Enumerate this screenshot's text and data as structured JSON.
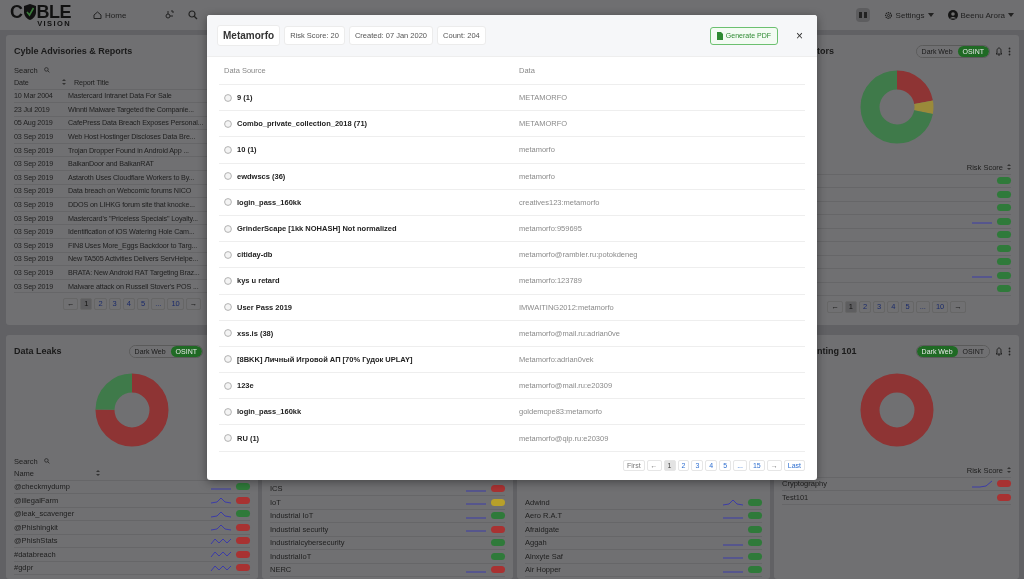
{
  "topbar": {
    "logo": {
      "left": "C",
      "right": "BLE",
      "tagline": "VISION"
    },
    "home": "Home",
    "settings": "Settings",
    "user": "Beenu Arora"
  },
  "advisories": {
    "title": "Cyble Advisories & Reports",
    "search": {
      "placeholder": "Search"
    },
    "columns": [
      "Date",
      "Report Title"
    ],
    "rows": [
      {
        "date": "10 Mar 2004",
        "title": "Mastercard Intranet Data For Sale"
      },
      {
        "date": "23 Jul 2019",
        "title": "Winnti Malware Targeted the Companie..."
      },
      {
        "date": "05 Aug 2019",
        "title": "CafePress Data Breach Exposes Personal..."
      },
      {
        "date": "03 Sep 2019",
        "title": "Web Host Hostinger Discloses Data Bre..."
      },
      {
        "date": "03 Sep 2019",
        "title": "Trojan Dropper Found in Android App ..."
      },
      {
        "date": "03 Sep 2019",
        "title": "BalkanDoor and BalkanRAT"
      },
      {
        "date": "03 Sep 2019",
        "title": "Astaroth Uses Cloudflare Workers to By..."
      },
      {
        "date": "03 Sep 2019",
        "title": "Data breach on Webcomic forums NICO"
      },
      {
        "date": "03 Sep 2019",
        "title": "DDOS on LIHKG forum site that knocke..."
      },
      {
        "date": "03 Sep 2019",
        "title": "Mastercard's \"Priceless Specials\" Loyalty..."
      },
      {
        "date": "03 Sep 2019",
        "title": "Identification of iOS Watering Hole Cam..."
      },
      {
        "date": "03 Sep 2019",
        "title": "FIN8 Uses More_Eggs Backdoor to Targ..."
      },
      {
        "date": "03 Sep 2019",
        "title": "New TA505 Activities Delivers ServHelpe..."
      },
      {
        "date": "03 Sep 2019",
        "title": "BRATA: New Android RAT Targeting Braz..."
      },
      {
        "date": "03 Sep 2019",
        "title": "Malware attack on Russell Stover's POS ..."
      }
    ],
    "pagination": {
      "prev": "←",
      "next": "→",
      "pages": [
        {
          "label": "1",
          "selected": true
        },
        {
          "label": "2",
          "selected": false
        },
        {
          "label": "3",
          "selected": false
        },
        {
          "label": "4",
          "selected": false
        },
        {
          "label": "5",
          "selected": false
        },
        {
          "label": "...",
          "selected": false
        },
        {
          "label": "10",
          "selected": false
        }
      ]
    }
  },
  "threat_panel": {
    "title": "tors",
    "toggle": [
      {
        "label": "Dark Web",
        "selected": false
      },
      {
        "label": "OSINT",
        "selected": true
      }
    ],
    "risk_header": "Risk Score",
    "rows": [
      {
        "color": "#2f7a3a"
      },
      {
        "color": "#2f7a3a"
      },
      {
        "color": "#2f7a3a"
      },
      {
        "color": "#2f7a3a",
        "kind": "flat"
      },
      {
        "color": "#2f7a3a"
      },
      {
        "color": "#2f7a3a"
      },
      {
        "color": "#2f7a3a"
      },
      {
        "color": "#2f7a3a",
        "kind": "flat"
      },
      {
        "color": "#2f7a3a"
      }
    ],
    "pagination": {
      "prev": "←",
      "next": "→",
      "pages": [
        {
          "label": "1",
          "selected": true
        },
        {
          "label": "2",
          "selected": false
        },
        {
          "label": "3",
          "selected": false
        },
        {
          "label": "4",
          "selected": false
        },
        {
          "label": "5",
          "selected": false
        },
        {
          "label": "...",
          "selected": false
        },
        {
          "label": "10",
          "selected": false
        }
      ]
    }
  },
  "data_leaks": {
    "title": "Data Leaks",
    "toggle": [
      {
        "label": "Dark Web",
        "selected": false
      },
      {
        "label": "OSINT",
        "selected": true
      }
    ],
    "search": {
      "placeholder": "Search"
    },
    "name_header": "Name",
    "rows": [
      {
        "name": "@checkmydump",
        "kind": "flat",
        "color": "#2f7a3a"
      },
      {
        "name": "@illegalFarm",
        "kind": "hump",
        "color": "#a83232"
      },
      {
        "name": "@leak_scavenger",
        "kind": "hump",
        "color": "#2f7a3a"
      },
      {
        "name": "@Phishingkit",
        "kind": "hump",
        "color": "#a83232"
      },
      {
        "name": "@PhishStats",
        "kind": "wave",
        "color": "#a83232"
      },
      {
        "name": "#databreach",
        "kind": "wave",
        "color": "#a83232"
      },
      {
        "name": "#gdpr",
        "kind": "wave",
        "color": "#a83232"
      }
    ]
  },
  "keyword_panel": {
    "rows": [
      {
        "name": "ICS",
        "kind": "flat",
        "color": "#a83232"
      },
      {
        "name": "IoT",
        "kind": "flat",
        "color": "#b8a02a"
      },
      {
        "name": "Industrial IoT",
        "kind": "flat",
        "color": "#2f7a3a"
      },
      {
        "name": "Industrial security",
        "kind": "flat",
        "color": "#a83232"
      },
      {
        "name": "Industrialcybersecurity",
        "color": "#2f7a3a"
      },
      {
        "name": "IndustrialIoT",
        "color": "#2f7a3a"
      },
      {
        "name": "NERC",
        "kind": "flat",
        "color": "#a83232"
      }
    ]
  },
  "malware_panel": {
    "rows": [
      {
        "name": "Adwind",
        "kind": "hump",
        "color": "#2f7a3a"
      },
      {
        "name": "Aero R.A.T",
        "kind": "flat",
        "color": "#2f7a3a"
      },
      {
        "name": "Afraidgate",
        "color": "#2f7a3a"
      },
      {
        "name": "Aggah",
        "kind": "flat",
        "color": "#2f7a3a"
      },
      {
        "name": "Alnxyte Saf",
        "kind": "flat",
        "color": "#2f7a3a"
      },
      {
        "name": "Air Hopper",
        "kind": "flat",
        "color": "#2f7a3a"
      }
    ]
  },
  "hunting_panel": {
    "title": "nting 101",
    "toggle": [
      {
        "label": "Dark Web",
        "selected": true
      },
      {
        "label": "OSINT",
        "selected": false
      }
    ],
    "risk_header": "Risk Score",
    "rows": [
      {
        "name": "Cryptography",
        "kind": "rise",
        "color": "#a83232"
      },
      {
        "name": "Test101",
        "color": "#a83232"
      }
    ]
  },
  "modal": {
    "title": "Metamorfo",
    "chips": [
      "Risk Score: 20",
      "Created: 07 Jan 2020",
      "Count: 204"
    ],
    "pdf_button": "Generate PDF",
    "close": "×",
    "columns": [
      "Data Source",
      "Data"
    ],
    "rows": [
      {
        "source": "9 (1)",
        "data": "METAMORFO"
      },
      {
        "source": "Combo_private_collection_2018 (71)",
        "data": "METAMORFO"
      },
      {
        "source": "10 (1)",
        "data": "metamorfo"
      },
      {
        "source": "ewdwscs (36)",
        "data": "metamorfo"
      },
      {
        "source": "login_pass_160kk",
        "data": "creatives123:metamorfo"
      },
      {
        "source": "GrinderScape [1kk NOHASH] Not normalized",
        "data": "metamorfo:959695"
      },
      {
        "source": "citiday-db",
        "data": "metamorfo@rambler.ru:potokdeneg"
      },
      {
        "source": "kys u retard",
        "data": "metamorfo:123789"
      },
      {
        "source": "User Pass 2019",
        "data": "IMWAITING2012:metamorfo"
      },
      {
        "source": "xss.is (38)",
        "data": "metamorfo@mail.ru:adrian0ve"
      },
      {
        "source": "[8BKK] Личный Игровой АП [70% Гудок UPLAY]",
        "data": "Metamorfo:adrian0vek"
      },
      {
        "source": "123e",
        "data": "metamorfo@mail.ru:e20309"
      },
      {
        "source": "login_pass_160kk",
        "data": "goldemcpe83:metamorfo"
      },
      {
        "source": "RU (1)",
        "data": "metamorfo@qip.ru:e20309"
      }
    ],
    "pagination": {
      "first": "First",
      "prev": "←",
      "next": "→",
      "last": "Last",
      "pages": [
        {
          "label": "1",
          "selected": true
        },
        {
          "label": "2",
          "selected": false
        },
        {
          "label": "3",
          "selected": false
        },
        {
          "label": "4",
          "selected": false
        },
        {
          "label": "5",
          "selected": false
        },
        {
          "label": "...",
          "selected": false
        },
        {
          "label": "15",
          "selected": false
        }
      ]
    }
  }
}
